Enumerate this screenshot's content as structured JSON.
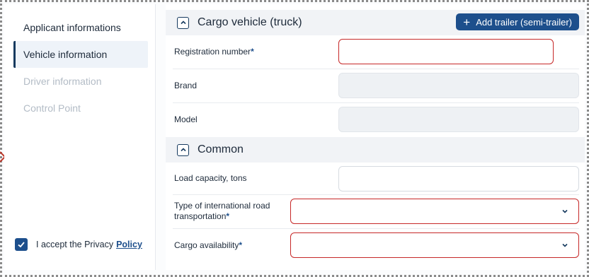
{
  "sidebar": {
    "items": [
      {
        "label": "Applicant informations",
        "state": "normal"
      },
      {
        "label": "Vehicle information",
        "state": "active"
      },
      {
        "label": "Driver information",
        "state": "disabled"
      },
      {
        "label": "Control Point",
        "state": "disabled"
      }
    ],
    "policy": {
      "text": "I accept the Privacy",
      "link": "Policy",
      "checked": true
    }
  },
  "sections": {
    "cargo_vehicle": {
      "title": "Cargo vehicle (truck)",
      "add_trailer_label": "Add trailer (semi-trailer)",
      "fields": {
        "registration": {
          "label": "Registration number",
          "required": "*",
          "value": ""
        },
        "brand": {
          "label": "Brand",
          "value": ""
        },
        "model": {
          "label": "Model",
          "value": ""
        }
      }
    },
    "common": {
      "title": "Common",
      "fields": {
        "load_capacity": {
          "label": "Load capacity, tons",
          "value": ""
        },
        "transport_type": {
          "label": "Type of international road transportation",
          "required": "*",
          "value": ""
        },
        "cargo_availability": {
          "label": "Cargo availability",
          "required": "*",
          "value": ""
        }
      }
    }
  },
  "colors": {
    "accent": "#1d4f8c",
    "error": "#c62828",
    "disabled_text": "#b3bcc6"
  },
  "icons": {
    "collapse": "chevron-up-icon",
    "select": "chevron-down-icon",
    "add": "plus-icon",
    "check": "check-icon"
  }
}
